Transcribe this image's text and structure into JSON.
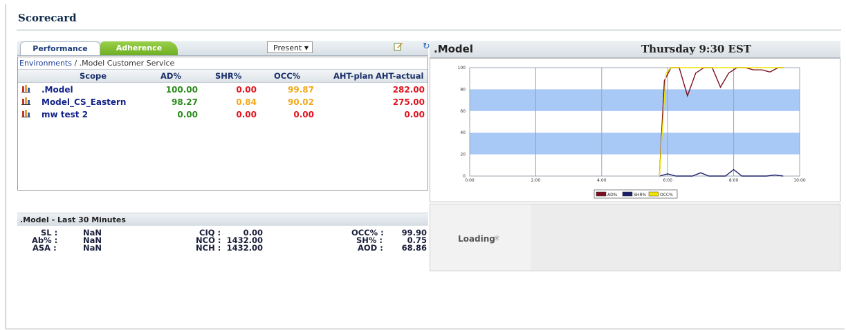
{
  "page": {
    "title": "Scorecard"
  },
  "tabs": {
    "performance": "Performance",
    "adherence": "Adherence"
  },
  "period": {
    "selected": "Present"
  },
  "breadcrumb": {
    "root": "Environments",
    "sep": " / ",
    "current": ".Model Customer Service"
  },
  "table": {
    "headers": [
      "Scope",
      "AD%",
      "SHR%",
      "OCC%",
      "AHT-plan",
      "AHT-actual"
    ],
    "rows": [
      {
        "scope": ".Model",
        "ad": "100.00",
        "shr": "0.00",
        "occ": "99.87",
        "aht_plan": "",
        "aht_actual": "282.00"
      },
      {
        "scope": "Model_CS_Eastern",
        "ad": "98.27",
        "shr": "0.84",
        "occ": "90.02",
        "aht_plan": "",
        "aht_actual": "275.00"
      },
      {
        "scope": "mw test 2",
        "ad": "0.00",
        "shr": "0.00",
        "occ": "0.00",
        "aht_plan": "",
        "aht_actual": "0.00"
      }
    ]
  },
  "summary": {
    "title": ".Model - Last 30 Minutes",
    "sl_label": "SL :",
    "sl": "NaN",
    "ab_label": "Ab% :",
    "ab": "NaN",
    "asa_label": "ASA :",
    "asa": "NaN",
    "ciq_label": "CIQ :",
    "ciq": "0.00",
    "nco_label": "NCO :",
    "nco": "1432.00",
    "nch_label": "NCH :",
    "nch": "1432.00",
    "occ_label": "OCC% :",
    "occ": "99.90",
    "sh_label": "SH% :",
    "sh": "0.75",
    "aod_label": "AOD :",
    "aod": "68.86"
  },
  "right": {
    "model": ".Model",
    "time": "Thursday 9:30 EST",
    "loading": "Loading"
  },
  "colors": {
    "ad": "#7a1020",
    "shr": "#1a1f6a",
    "occ": "#f2e300",
    "band": "#a8c8f5",
    "green": "#2a8a1a",
    "red": "#e0141e",
    "orange": "#f0a91a"
  },
  "chart_data": {
    "type": "line",
    "x_ticks": [
      "0:00",
      "2:00",
      "4:00",
      "6:00",
      "8:00",
      "10:00"
    ],
    "y_ticks": [
      "0",
      "20",
      "40",
      "60",
      "80",
      "100"
    ],
    "ylim": [
      0,
      100
    ],
    "xlim_hours": [
      0,
      10
    ],
    "shaded_bands": [
      [
        20,
        40
      ],
      [
        60,
        80
      ]
    ],
    "series": [
      {
        "name": "AD%",
        "x": [
          5.75,
          5.9,
          6.1,
          6.35,
          6.6,
          6.85,
          7.1,
          7.35,
          7.6,
          7.85,
          8.1,
          8.35,
          8.6,
          8.85,
          9.1,
          9.35,
          9.5
        ],
        "y": [
          0,
          88,
          100,
          100,
          74,
          95,
          100,
          100,
          82,
          95,
          100,
          100,
          98,
          98,
          96,
          100,
          100
        ]
      },
      {
        "name": "SHR%",
        "x": [
          5.75,
          6.0,
          6.25,
          6.5,
          6.75,
          7.0,
          7.25,
          7.5,
          7.75,
          8.0,
          8.25,
          8.5,
          8.75,
          9.0,
          9.25,
          9.5
        ],
        "y": [
          0,
          2,
          0,
          0,
          0,
          3,
          0,
          0,
          0,
          6,
          0,
          0,
          0,
          0,
          1,
          0
        ]
      },
      {
        "name": "OCC%",
        "x": [
          5.75,
          5.95,
          6.1,
          6.5,
          7.0,
          7.5,
          8.0,
          8.5,
          9.0,
          9.5
        ],
        "y": [
          0,
          95,
          100,
          100,
          100,
          100,
          100,
          100,
          100,
          100
        ]
      }
    ]
  }
}
